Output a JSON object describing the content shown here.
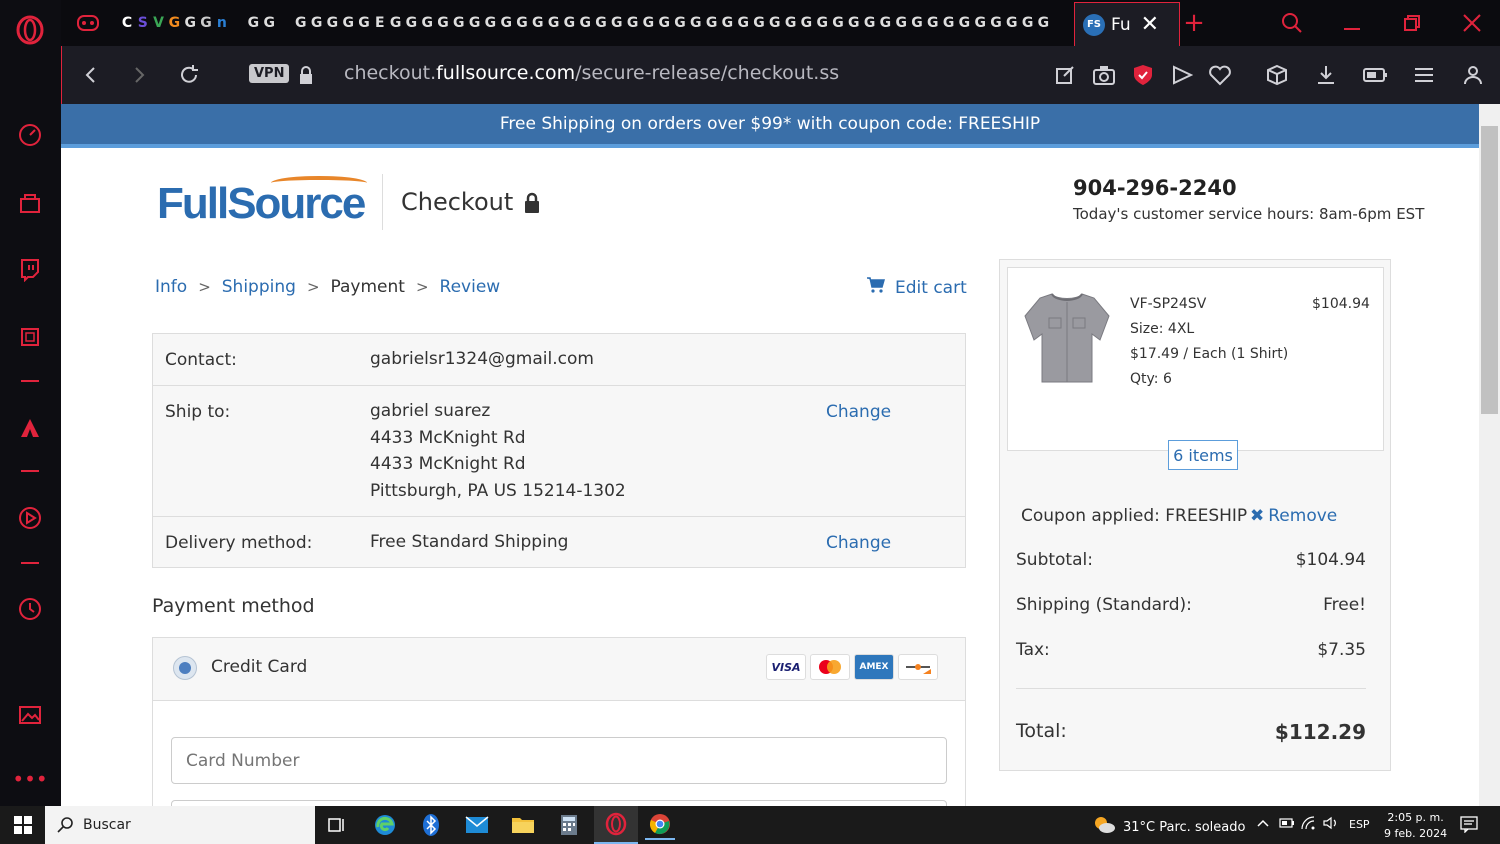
{
  "browser": {
    "active_tab_label": "Fu",
    "active_tab_favicon": "FS",
    "vpn_label": "VPN",
    "url_prefix": "checkout.",
    "url_domain": "fullsource.com",
    "url_path": "/secure-release/checkout.ss",
    "mini_tabs": [
      "C",
      "S",
      "V",
      "G",
      "G",
      "G",
      "n",
      "",
      "G",
      "G",
      "",
      "G",
      "G",
      "G",
      "G",
      "G",
      "E",
      "G",
      "G",
      "G",
      "G",
      "G",
      "G",
      "G",
      "G",
      "G",
      "G",
      "G",
      "G",
      "G",
      "G",
      "G",
      "G",
      "G",
      "G",
      "G",
      "G",
      "G",
      "G",
      "G",
      "G",
      "G",
      "G",
      "G",
      "G",
      "G",
      "G",
      "G",
      "G",
      "G",
      "G",
      "G",
      "G",
      "G",
      "G",
      "G",
      "G",
      "G",
      "G"
    ]
  },
  "promo": {
    "text": "Free Shipping on orders over $99* with coupon code: FREESHIP",
    "bg_color": "#3a6fa8"
  },
  "header": {
    "logo_full": "Full",
    "logo_source": "Source",
    "title": "Checkout",
    "phone": "904-296-2240",
    "hours": "Today's customer service hours: 8am-6pm EST"
  },
  "breadcrumb": {
    "items": [
      "Info",
      "Shipping",
      "Payment",
      "Review"
    ],
    "edit_cart": "Edit cart"
  },
  "info": {
    "contact_label": "Contact:",
    "contact_value": "gabrielsr1324@gmail.com",
    "ship_label": "Ship to:",
    "ship_lines": [
      "gabriel suarez",
      "4433 McKnight Rd",
      "4433 McKnight Rd",
      "Pittsburgh, PA US 15214-1302"
    ],
    "ship_change": "Change",
    "delivery_label": "Delivery method:",
    "delivery_value": "Free Standard Shipping",
    "delivery_change": "Change"
  },
  "payment": {
    "title": "Payment method",
    "option_label": "Credit Card",
    "card_logos": [
      "VISA",
      "mastercard",
      "AMEX",
      "discover"
    ],
    "card_number_placeholder": "Card Number"
  },
  "summary": {
    "item": {
      "sku": "VF-SP24SV",
      "price": "$104.94",
      "size": "Size: 4XL",
      "each": "$17.49 / Each (1 Shirt)",
      "qty": "Qty: 6"
    },
    "items_count": "6 items",
    "coupon": "Coupon applied: FREESHIP",
    "remove": "Remove",
    "subtotal_label": "Subtotal:",
    "subtotal_value": "$104.94",
    "shipping_label": "Shipping (Standard):",
    "shipping_value": "Free!",
    "tax_label": "Tax:",
    "tax_value": "$7.35",
    "total_label": "Total:",
    "total_value": "$112.29"
  },
  "taskbar": {
    "search_label": "Buscar",
    "weather": "31°C  Parc. soleado",
    "lang": "ESP",
    "time": "2:05 p. m.",
    "date": "9 feb. 2024"
  }
}
